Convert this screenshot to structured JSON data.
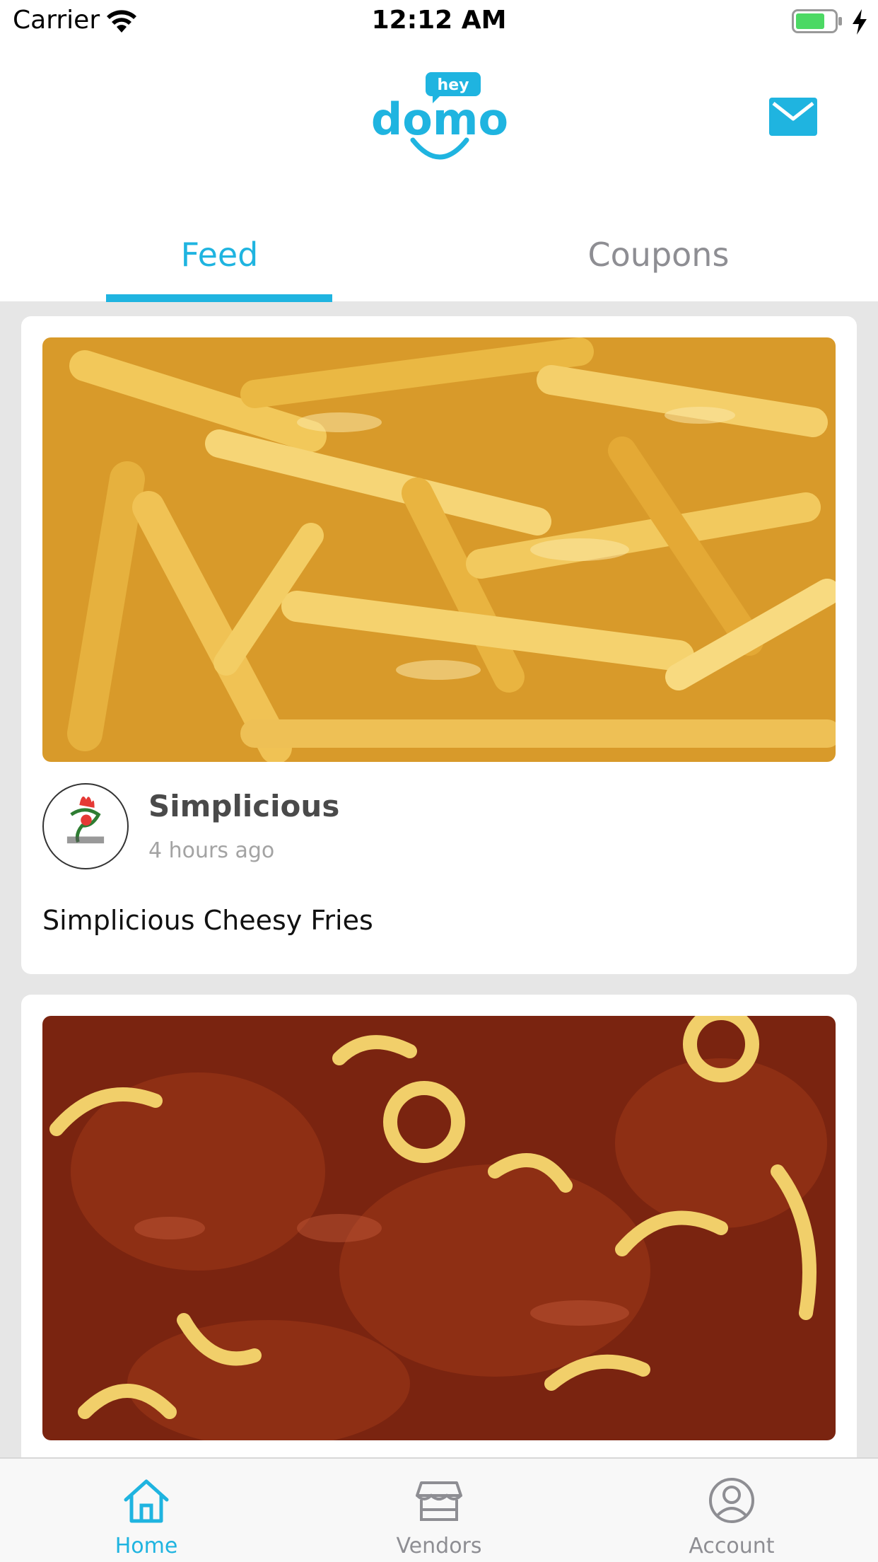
{
  "status_bar": {
    "carrier": "Carrier",
    "time": "12:12 AM",
    "battery_color": "#4cd964"
  },
  "header": {
    "logo_small": "hey",
    "logo_main": "domo",
    "mail_icon": "envelope-icon"
  },
  "colors": {
    "accent": "#1fb4e0",
    "inactive": "#8e8e93"
  },
  "tabs": [
    {
      "label": "Feed",
      "active": true
    },
    {
      "label": "Coupons",
      "active": false
    }
  ],
  "feed": [
    {
      "vendor": "Simplicious",
      "time": "4 hours ago",
      "title": "Simplicious Cheesy Fries"
    },
    {
      "vendor": "",
      "time": "",
      "title": ""
    }
  ],
  "tab_bar": [
    {
      "label": "Home",
      "icon": "home-icon",
      "active": true
    },
    {
      "label": "Vendors",
      "icon": "store-icon",
      "active": false
    },
    {
      "label": "Account",
      "icon": "account-icon",
      "active": false
    }
  ]
}
